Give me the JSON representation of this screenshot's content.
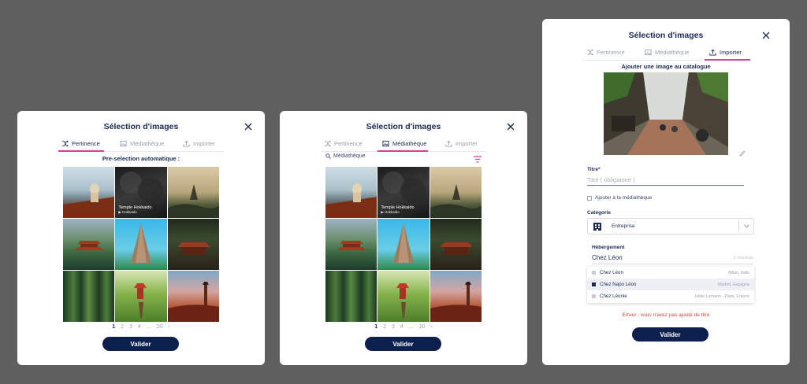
{
  "modal_left": {
    "title": "Sélection d'images",
    "tabs": [
      {
        "label": "Pertinence",
        "icon": "shuffle-icon",
        "active": true
      },
      {
        "label": "Médiathèque",
        "icon": "image-icon",
        "active": false
      },
      {
        "label": "Importer",
        "icon": "upload-icon",
        "active": false
      }
    ],
    "subtitle": "Pre-selection automatique :",
    "tile_caption": "Temple Hokkaido",
    "tile_subcaption": "▶ Hokkaido",
    "pagination": [
      "1",
      "2",
      "3",
      "4",
      "...",
      "20"
    ],
    "submit_label": "Valider"
  },
  "modal_middle": {
    "title": "Sélection d'images",
    "tabs": [
      {
        "label": "Pertinence",
        "icon": "shuffle-icon",
        "active": false
      },
      {
        "label": "Médiathèque",
        "icon": "image-icon",
        "active": true
      },
      {
        "label": "Importer",
        "icon": "upload-icon",
        "active": false
      }
    ],
    "search_value": "Médiathèque",
    "tile_caption": "Temple Hokkaido",
    "tile_subcaption": "▶ Hokkaido",
    "pagination": [
      "1",
      "2",
      "3",
      "4",
      "...",
      "20"
    ],
    "submit_label": "Valider"
  },
  "modal_right": {
    "title": "Sélection d'images",
    "tabs": [
      {
        "label": "Pertinence",
        "icon": "shuffle-icon",
        "active": false
      },
      {
        "label": "Médiathèque",
        "icon": "image-icon",
        "active": false
      },
      {
        "label": "Importer",
        "icon": "upload-icon",
        "active": true
      }
    ],
    "upload_heading": "Ajouter une image au catalogue",
    "title_label": "Titre*",
    "title_placeholder": "Titre ( obligatoire )",
    "add_to_library_label": "Ajouter à la médiathèque",
    "category_label": "Catégorie",
    "category_value": "Entreprise",
    "lodging_label": "Hébergement",
    "lodging_value": "Chez Léon",
    "lodging_results": "3 résultats",
    "options": [
      {
        "name": "Chez Léon",
        "location": "Milan, Italie",
        "highlighted": false
      },
      {
        "name": "Chez Napo Léon",
        "location": "Madrid, Espagne",
        "highlighted": true
      },
      {
        "name": "Chez Léonie",
        "location": "Hotel Lemarin - Paris, France",
        "highlighted": false
      }
    ],
    "error_message": "Erreur : vous n'avez pas ajouté de titre",
    "submit_label": "Valider"
  },
  "colors": {
    "accent": "#d6409a",
    "primary": "#0d1f4d",
    "error": "#d0473b",
    "background": "#5f5f5f"
  }
}
